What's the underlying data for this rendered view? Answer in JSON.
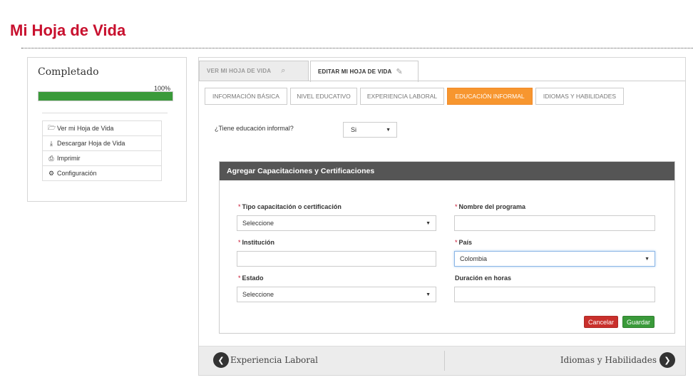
{
  "page": {
    "title": "Mi Hoja de Vida"
  },
  "sidebar": {
    "heading": "Completado",
    "progress_label": "100%",
    "progress_value": 100,
    "menu": [
      {
        "label": "Ver mi Hoja de Vida",
        "icon": "folder-open-icon"
      },
      {
        "label": "Descargar Hoja de Vida",
        "icon": "download-icon"
      },
      {
        "label": "Imprimir",
        "icon": "print-icon"
      },
      {
        "label": "Configuración",
        "icon": "gear-icon"
      }
    ]
  },
  "main_tabs": [
    {
      "label": "VER MI HOJA DE VIDA",
      "icon": "search-document-icon",
      "active": false
    },
    {
      "label": "EDITAR MI HOJA DE VIDA",
      "icon": "edit-icon",
      "active": true
    }
  ],
  "sub_tabs": [
    {
      "label": "INFORMACIÓN BÁSICA",
      "active": false
    },
    {
      "label": "NIVEL EDUCATIVO",
      "active": false
    },
    {
      "label": "EXPERIENCIA LABORAL",
      "active": false
    },
    {
      "label": "EDUCACIÓN INFORMAL",
      "active": true
    },
    {
      "label": "IDIOMAS Y HABILIDADES",
      "active": false
    }
  ],
  "question": {
    "label": "¿Tiene educación informal?",
    "value": "Si"
  },
  "form": {
    "heading": "Agregar Capacitaciones y Certificaciones",
    "required_mark": "*",
    "tipo": {
      "label": "Tipo capacitación o certificación",
      "value": "Seleccione"
    },
    "nombre": {
      "label": "Nombre del programa",
      "value": ""
    },
    "institucion": {
      "label": "Institución",
      "value": ""
    },
    "pais": {
      "label": "País",
      "value": "Colombia"
    },
    "estado": {
      "label": "Estado",
      "value": "Seleccione"
    },
    "duracion": {
      "label": "Duración en horas",
      "value": ""
    },
    "cancel_label": "Cancelar",
    "save_label": "Guardar"
  },
  "nav": {
    "prev_label": "Experiencia Laboral",
    "next_label": "Idiomas y Habilidades"
  },
  "colors": {
    "brand_red": "#c8102e",
    "active_orange": "#f7962f",
    "success_green": "#3a9a3a",
    "danger_red": "#c9302c"
  }
}
